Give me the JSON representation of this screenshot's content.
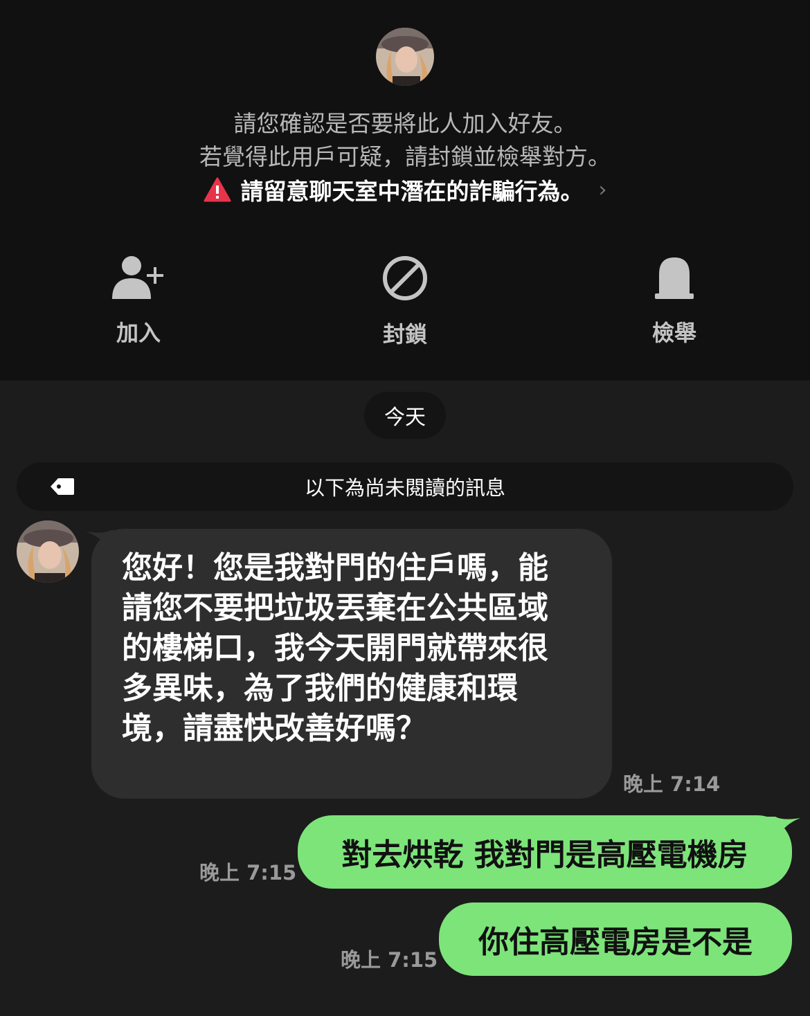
{
  "notice": {
    "line1": "請您確認是否要將此人加入好友。",
    "line2": "若覺得此用戶可疑，請封鎖並檢舉對方。",
    "warning": "請留意聊天室中潛在的詐騙行為。",
    "warning_icon": "warning-icon"
  },
  "actions": [
    {
      "label": "加入",
      "icon": "add-friend-icon"
    },
    {
      "label": "封鎖",
      "icon": "block-icon"
    },
    {
      "label": "檢舉",
      "icon": "report-icon"
    }
  ],
  "chat": {
    "date_divider": "今天",
    "unread_divider": "以下為尚未閱讀的訊息",
    "messages": [
      {
        "direction": "incoming",
        "lines": [
          "您好！您是我對門的住戶嗎，能",
          "請您不要把垃圾丟棄在公共區域",
          "的樓梯口，我今天開門就帶來很",
          "多異味，為了我們的健康和環",
          "境，請盡快改善好嗎？"
        ],
        "time": "晚上 7:14"
      },
      {
        "direction": "outgoing",
        "text": "對去烘乾 我對門是高壓電機房",
        "time": "晚上 7:15"
      },
      {
        "direction": "outgoing",
        "text": "你住高壓電房是不是",
        "time": "晚上 7:15"
      }
    ]
  },
  "colors": {
    "outgoing_bubble": "#7de47a",
    "incoming_bubble": "#2e2e2e",
    "warning_red": "#e8344a",
    "background": "#1c1c1c"
  }
}
